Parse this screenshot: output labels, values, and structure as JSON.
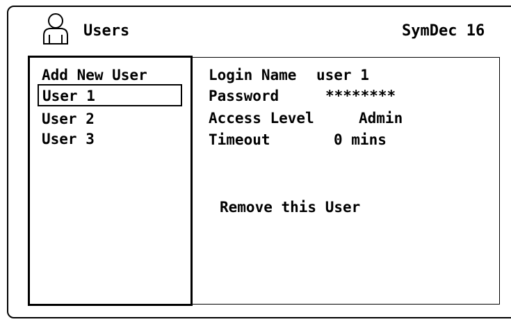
{
  "header": {
    "title": "Users",
    "right_text": "SymDec 16",
    "icon": "user-icon"
  },
  "sidebar": {
    "items": [
      {
        "label": "Add New User"
      },
      {
        "label": "User 1",
        "selected": true
      },
      {
        "label": "User 2"
      },
      {
        "label": "User 3"
      }
    ]
  },
  "details": {
    "login_name": {
      "label": "Login Name",
      "value": "user 1"
    },
    "password": {
      "label": "Password",
      "value": "********"
    },
    "access_level": {
      "label": "Access Level",
      "value": "Admin"
    },
    "timeout": {
      "label": "Timeout",
      "value": "0 mins"
    }
  },
  "actions": {
    "remove_label": "Remove this User"
  }
}
